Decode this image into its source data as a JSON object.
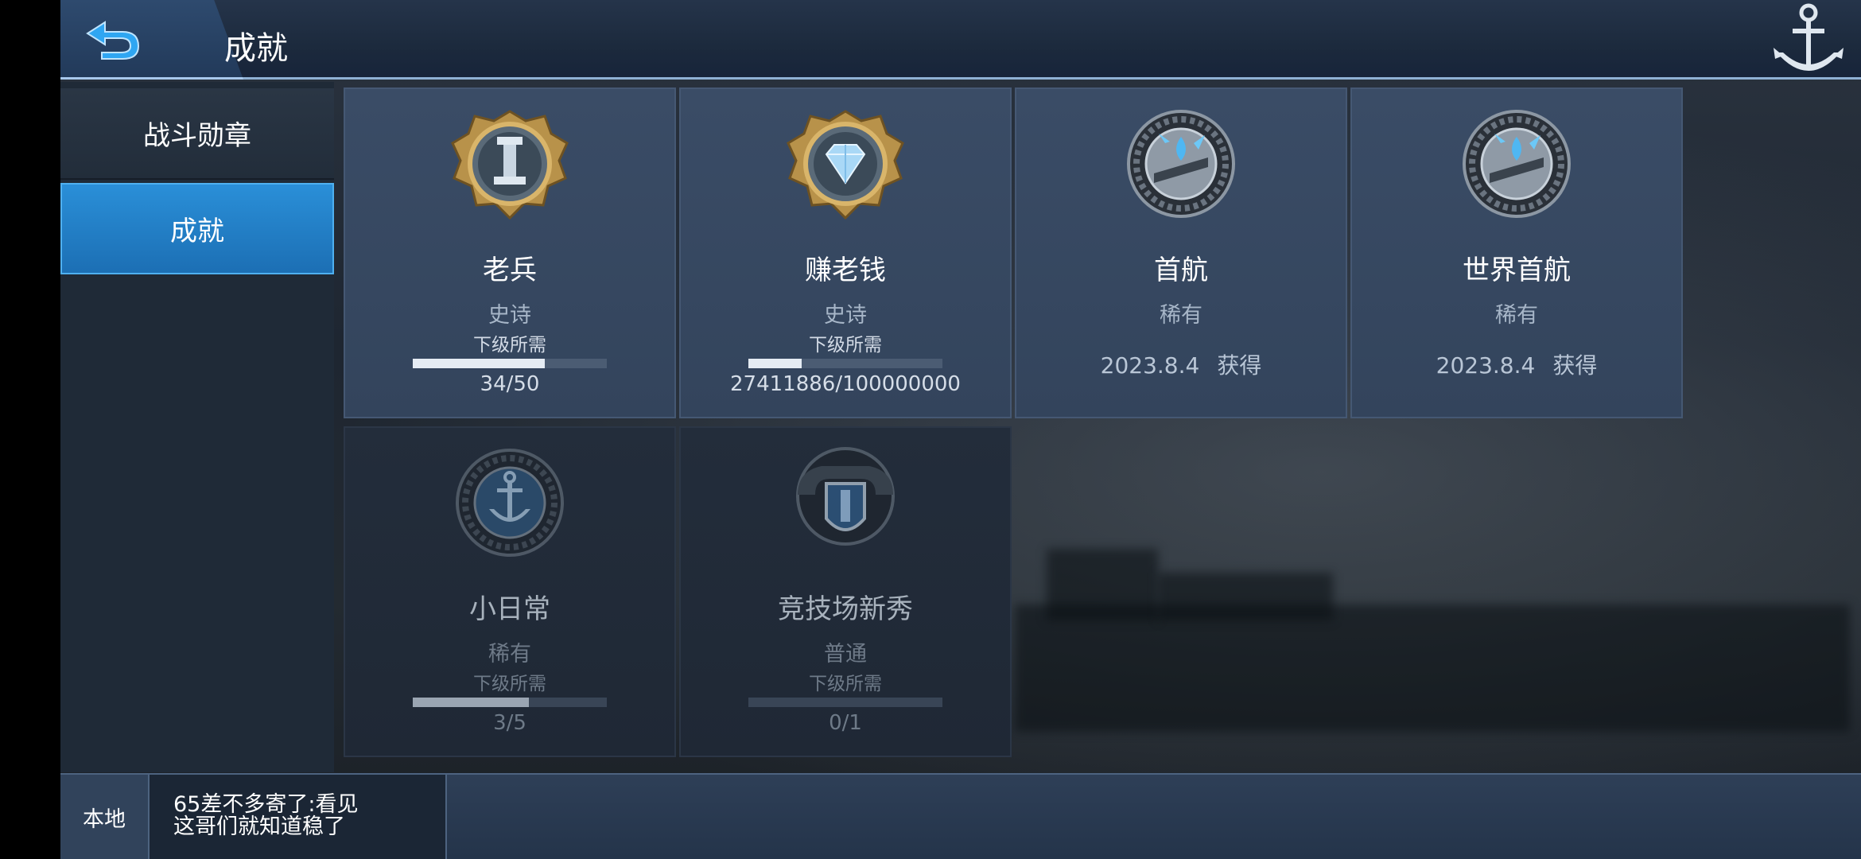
{
  "header": {
    "title": "成就"
  },
  "sidebar": {
    "items": [
      {
        "label": "战斗勋章",
        "active": false
      },
      {
        "label": "成就",
        "active": true
      }
    ]
  },
  "achievements": [
    {
      "name": "老兵",
      "rarity": "史诗",
      "requirement_label": "下级所需",
      "progress": "34/50",
      "progress_fraction": 0.68,
      "medal": "veteran-medal-icon"
    },
    {
      "name": "赚老钱",
      "rarity": "史诗",
      "requirement_label": "下级所需",
      "progress": "27411886/100000000",
      "progress_fraction": 0.274,
      "medal": "diamond-medal-icon"
    },
    {
      "name": "首航",
      "rarity": "稀有",
      "date": "2023.8.4",
      "obtained_label": "获得",
      "medal": "maiden-voyage-medal-icon"
    },
    {
      "name": "世界首航",
      "rarity": "稀有",
      "date": "2023.8.4",
      "obtained_label": "获得",
      "medal": "world-voyage-medal-icon"
    },
    {
      "name": "小日常",
      "rarity": "稀有",
      "requirement_label": "下级所需",
      "progress": "3/5",
      "progress_fraction": 0.6,
      "medal": "anchor-medal-icon"
    },
    {
      "name": "竞技场新秀",
      "rarity": "普通",
      "requirement_label": "下级所需",
      "progress": "0/1",
      "progress_fraction": 0.0,
      "medal": "arena-shield-medal-icon"
    }
  ],
  "chat": {
    "channel": "本地",
    "line1": "65差不多寄了:看见",
    "line2": "这哥们就知道稳了"
  },
  "colors": {
    "accent_blue": "#1c6fb4",
    "card_bg": "#3a4c66",
    "locked_card_bg": "#232d3b"
  }
}
